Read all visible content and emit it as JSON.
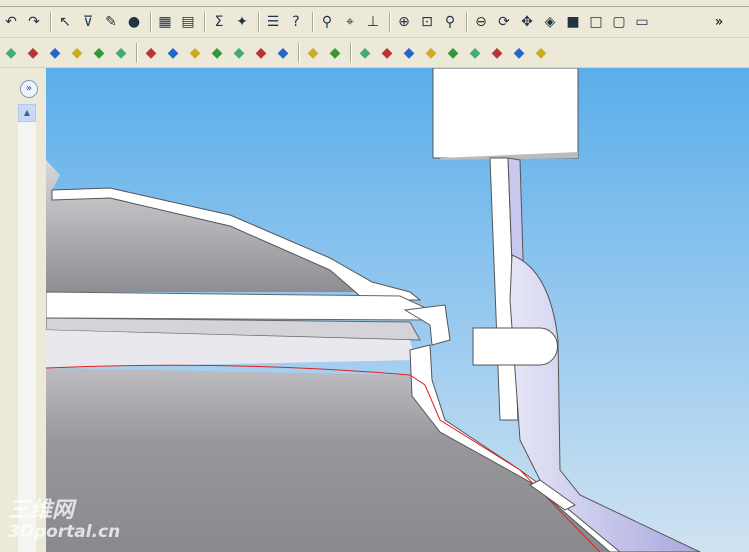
{
  "toolbar_row1": {
    "icons": [
      "undo-icon",
      "redo-icon",
      "select-icon",
      "selection-filter-icon",
      "sketch-icon",
      "rebuild-light-icon",
      "appearance-icon",
      "texture-icon",
      "equation-icon",
      "photoworks-icon",
      "options-icon",
      "help-icon",
      "light-icon",
      "camera-icon",
      "coordinate-icon",
      "zoom-fit-icon",
      "zoom-area-icon",
      "zoom-in-out-icon",
      "zoom-selection-icon",
      "rotate-icon",
      "pan-icon",
      "view-orientation-icon",
      "display-style-icon",
      "wireframe-icon",
      "hidden-lines-visible-icon",
      "hidden-lines-removed-icon"
    ],
    "overflow": "»"
  },
  "toolbar_row2": {
    "icons": [
      "extrude-icon",
      "revolve-icon",
      "sweep-icon",
      "shell-icon",
      "chamfer-icon",
      "fillet-icon",
      "draft-icon",
      "linear-pattern-icon",
      "circular-pattern-icon",
      "mirror-icon",
      "rib-icon",
      "wrap-icon",
      "dome-icon",
      "reference-geometry-icon",
      "curves-icon",
      "3d-sketch-icon",
      "smart-dimension-icon",
      "hole-wizard-icon",
      "move-face-icon",
      "split-line-icon",
      "intersect-icon",
      "surface-icon",
      "angle-icon",
      "frame-icon"
    ]
  },
  "left_panel": {
    "expand": "»",
    "scroll_up": "▲"
  },
  "watermark": {
    "line1": "三维网",
    "line2": "3Dportal.cn"
  },
  "colors": {
    "background_top": "#5aaeea",
    "background_bottom": "#cfe3f1",
    "section_line": "#e02020",
    "part_gray": "#9a9a9e",
    "lavender": "#c8c8ee"
  }
}
